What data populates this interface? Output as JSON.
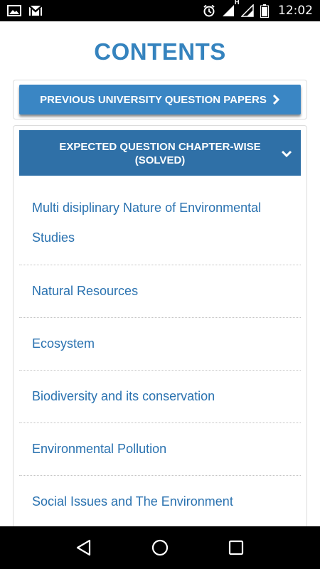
{
  "status_bar": {
    "time": "12:02",
    "left_icons": [
      "image-icon",
      "gmail-icon"
    ],
    "right_icons": [
      "alarm-icon",
      "signal-icon",
      "h-network-icon",
      "signal-icon",
      "battery-icon"
    ],
    "network_label": "H"
  },
  "page": {
    "title": "CONTENTS"
  },
  "previous_papers": {
    "label": "PREVIOUS UNIVERSITY QUESTION PAPERS",
    "icon": "chevron-right-icon"
  },
  "expected_questions": {
    "label": "EXPECTED QUESTION CHAPTER-WISE (SOLVED)",
    "icon": "chevron-down-icon"
  },
  "chapters": [
    "Multi disiplinary Nature of Environmental Studies",
    "Natural Resources",
    "Ecosystem",
    "Biodiversity and its conservation",
    "Environmental Pollution",
    "Social Issues and The Environment"
  ],
  "nav_bar": {
    "buttons": [
      "back-icon",
      "home-icon",
      "recents-icon"
    ]
  },
  "colors": {
    "title": "#3583be",
    "button": "#3a86c4",
    "header": "#2f70a7",
    "link": "#2a72b0"
  }
}
